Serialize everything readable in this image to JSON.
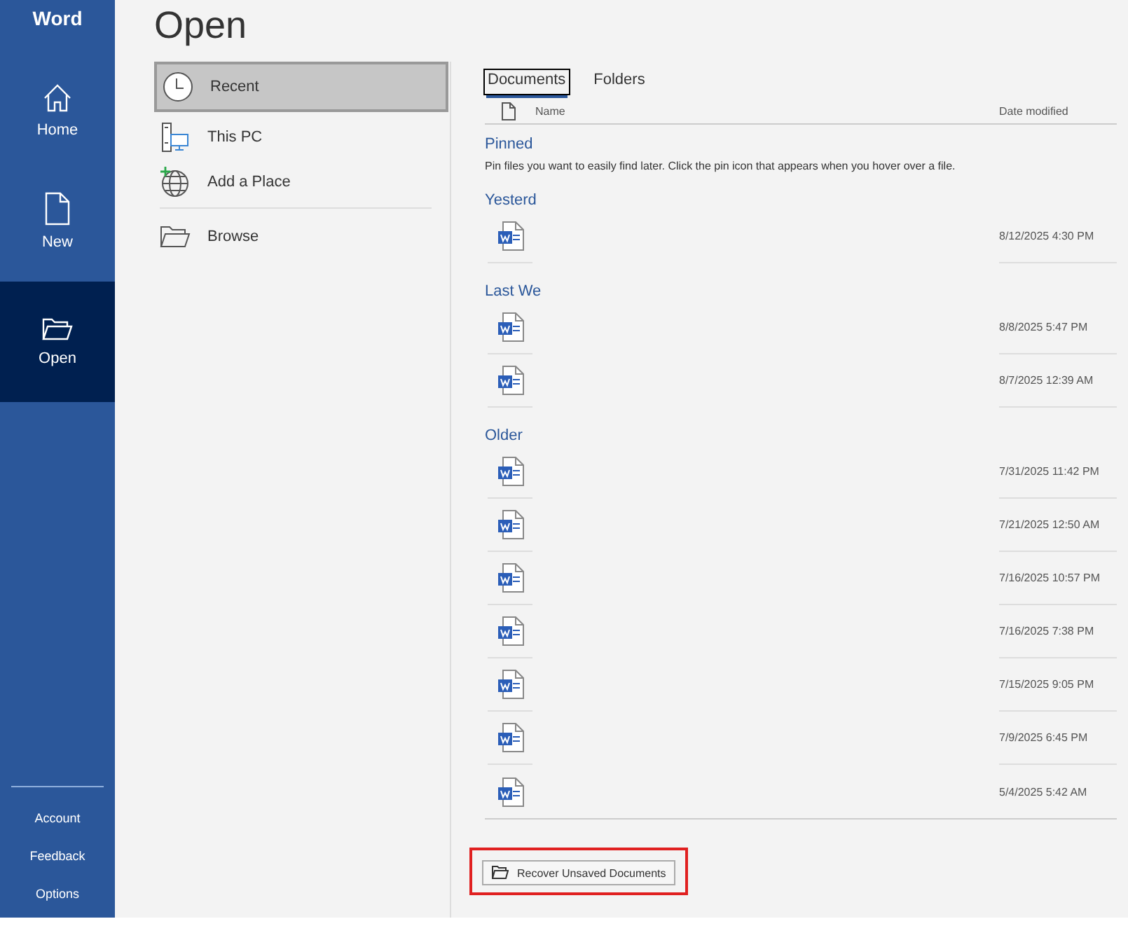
{
  "app": {
    "title": "Word"
  },
  "sidebar": {
    "items": [
      {
        "label": "Home",
        "kind": "home",
        "selected": false
      },
      {
        "label": "New",
        "kind": "new",
        "selected": false
      },
      {
        "label": "Open",
        "kind": "open",
        "selected": true
      }
    ],
    "footer": [
      "Account",
      "Feedback",
      "Options"
    ]
  },
  "page": {
    "title": "Open"
  },
  "locations": [
    [
      {
        "label": "Recent",
        "kind": "clock",
        "selected": true
      },
      {
        "label": "This PC",
        "kind": "pc",
        "selected": false
      },
      {
        "label": "Add a Place",
        "kind": "globe",
        "selected": false
      }
    ],
    [
      {
        "label": "Browse",
        "kind": "folder",
        "selected": false
      }
    ]
  ],
  "tabs": [
    {
      "label": "Documents",
      "selected": true
    },
    {
      "label": "Folders",
      "selected": false
    }
  ],
  "columns": {
    "name": "Name",
    "date": "Date modified"
  },
  "groups": [
    {
      "title": "Pinned",
      "note": "Pin files you want to easily find later. Click the pin icon that appears when you hover over a file."
    },
    {
      "title": "Yesterd",
      "files": [
        {
          "date": "8/12/2025 4:30 PM"
        }
      ]
    },
    {
      "title": "Last We",
      "files": [
        {
          "date": "8/8/2025 5:47 PM"
        },
        {
          "date": "8/7/2025 12:39 AM"
        }
      ]
    },
    {
      "title": "Older",
      "files": [
        {
          "date": "7/31/2025 11:42 PM"
        },
        {
          "date": "7/21/2025 12:50 AM"
        },
        {
          "date": "7/16/2025 10:57 PM"
        },
        {
          "date": "7/16/2025 7:38 PM"
        },
        {
          "date": "7/15/2025 9:05 PM"
        },
        {
          "date": "7/9/2025 6:45 PM"
        },
        {
          "date": "5/4/2025 5:42 AM"
        }
      ]
    }
  ],
  "recover_button": {
    "label": "Recover Unsaved Documents",
    "highlighted": true
  }
}
